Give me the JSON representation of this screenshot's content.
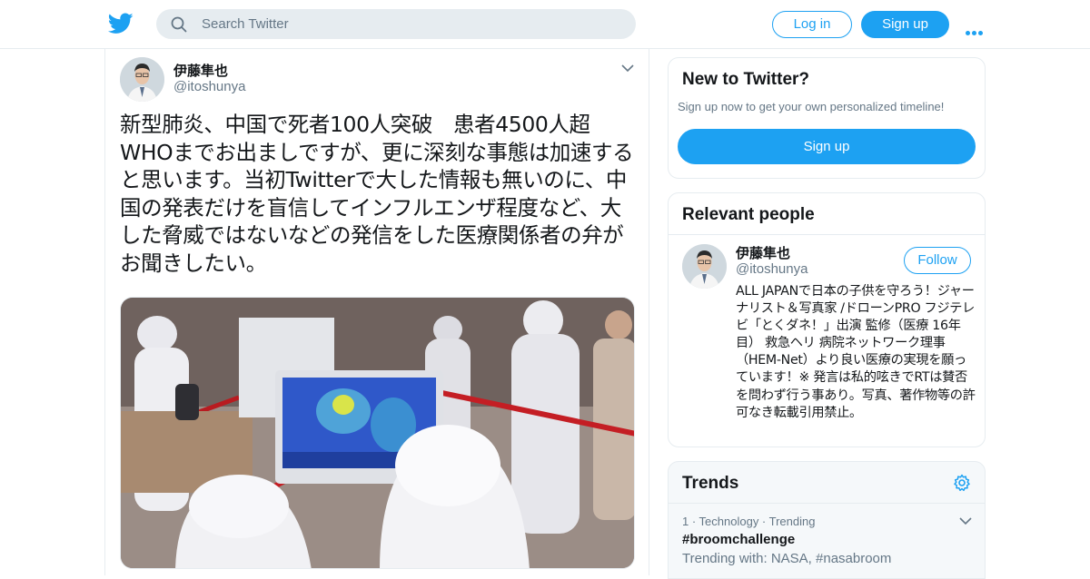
{
  "header": {
    "search_placeholder": "Search Twitter",
    "login_label": "Log in",
    "signup_label": "Sign up",
    "brand_color": "#1da1f2"
  },
  "tweet": {
    "display_name": "伊藤隼也",
    "handle": "@itoshunya",
    "text": "新型肺炎、中国で死者100人突破　患者4500人超\nWHOまでお出ましですが、更に深刻な事態は加速すると思います。当初Twitterで大した情報も無いのに、中国の発表だけを盲信してインフルエンザ程度など、大した脅威ではないなどの発信をした医療関係者の弁がお聞きしたい。"
  },
  "sidebar": {
    "new_to_twitter": {
      "title": "New to Twitter?",
      "subtitle": "Sign up now to get your own personalized timeline!",
      "button_label": "Sign up"
    },
    "relevant_people": {
      "title": "Relevant people",
      "person": {
        "display_name": "伊藤隼也",
        "handle": "@itoshunya",
        "follow_label": "Follow",
        "bio": "ALL JAPANで日本の子供を守ろう！ジャーナリスト＆写真家 /ドローンPRO フジテレビ「とくダネ！」出演 監修（医療 16年目） 救急ヘリ 病院ネットワーク理事（HEM-Net）より良い医療の実現を願っています！※ 発言は私的呟きでRTは賛否を問わず行う事あり。写真、著作物等の許可なき転載引用禁止。"
      }
    },
    "trends": {
      "title": "Trends",
      "items": [
        {
          "meta": "1 · Technology · Trending",
          "name": "#broomchallenge",
          "with": "Trending with: NASA, #nasabroom"
        }
      ]
    }
  }
}
